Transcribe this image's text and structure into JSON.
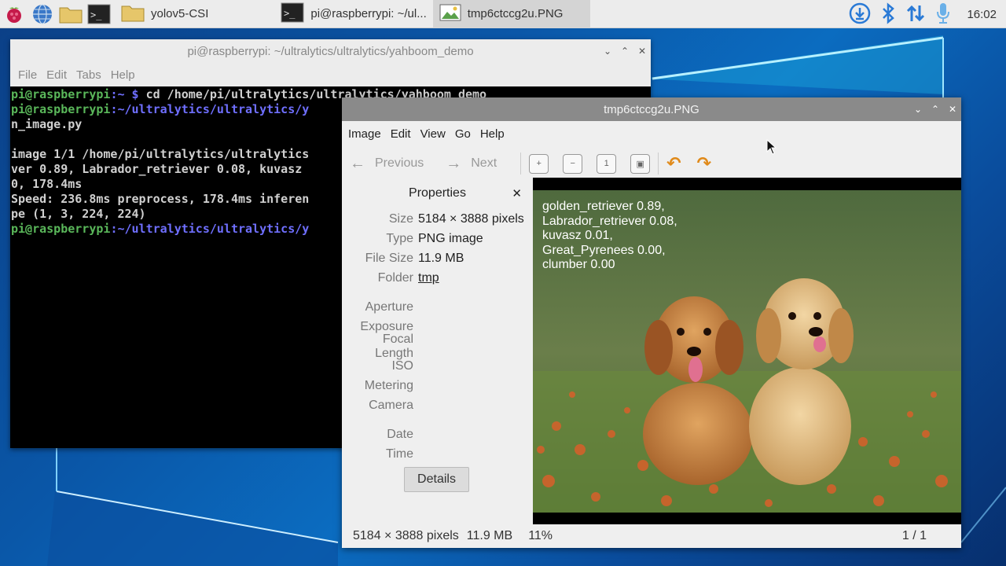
{
  "taskbar": {
    "apps": [
      {
        "label": "yolov5-CSI",
        "icon": "folder-icon"
      },
      {
        "label": "pi@raspberrypi: ~/ul...",
        "icon": "terminal-icon"
      },
      {
        "label": "tmp6ctccg2u.PNG",
        "icon": "image-viewer-icon",
        "active": true
      }
    ],
    "clock": "16:02"
  },
  "terminal": {
    "title": "pi@raspberrypi: ~/ultralytics/ultralytics/yahboom_demo",
    "menu": [
      "File",
      "Edit",
      "Tabs",
      "Help"
    ],
    "lines": {
      "l1_prompt_user": "pi@raspberrypi",
      "l1_prompt_path": ":~ $ ",
      "l1_cmd": "cd /home/pi/ultralytics/ultralytics/yahboom_demo",
      "l2_prompt_user": "pi@raspberrypi",
      "l2_prompt_path": ":~/ultralytics/ultralytics/y",
      "l3": "n_image.py",
      "l4": "",
      "l5": "image 1/1 /home/pi/ultralytics/ultralytics",
      "l6": "ver 0.89, Labrador_retriever 0.08, kuvasz ",
      "l7": "0, 178.4ms",
      "l8": "Speed: 236.8ms preprocess, 178.4ms inferen",
      "l9": "pe (1, 3, 224, 224)",
      "l10_prompt_user": "pi@raspberrypi",
      "l10_prompt_path": ":~/ultralytics/ultralytics/y"
    }
  },
  "viewer": {
    "title": "tmp6ctccg2u.PNG",
    "menu": [
      "Image",
      "Edit",
      "View",
      "Go",
      "Help"
    ],
    "toolbar": {
      "previous": "Previous",
      "next": "Next"
    },
    "properties": {
      "heading": "Properties",
      "size_label": "Size",
      "size_value": "5184 × 3888 pixels",
      "type_label": "Type",
      "type_value": "PNG image",
      "filesize_label": "File Size",
      "filesize_value": "11.9 MB",
      "folder_label": "Folder",
      "folder_value": "tmp",
      "aperture_label": "Aperture",
      "exposure_label": "Exposure",
      "focal_label": "Focal Length",
      "iso_label": "ISO",
      "metering_label": "Metering",
      "camera_label": "Camera",
      "date_label": "Date",
      "time_label": "Time",
      "details_button": "Details"
    },
    "overlay_lines": [
      "golden_retriever 0.89,",
      "Labrador_retriever 0.08,",
      "kuvasz 0.01,",
      "Great_Pyrenees 0.00,",
      "clumber 0.00"
    ],
    "status": {
      "dims": "5184 × 3888 pixels",
      "size": "11.9 MB",
      "zoom": "11%",
      "pages": "1 / 1"
    }
  }
}
